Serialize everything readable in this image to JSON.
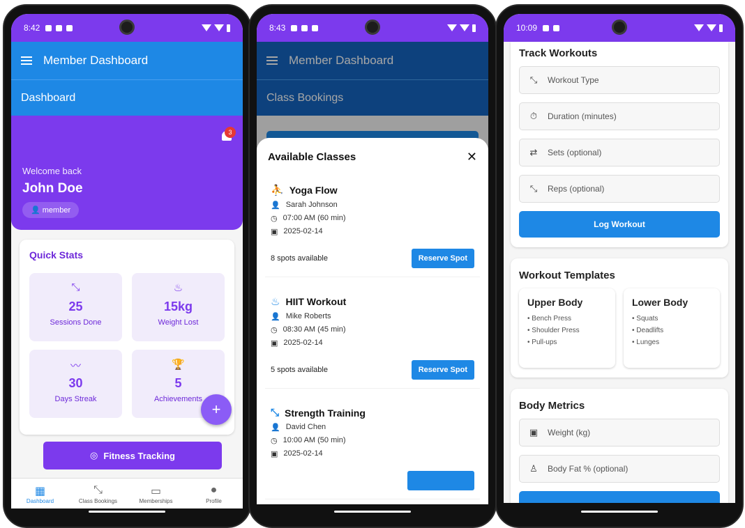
{
  "phone1": {
    "status_time": "8:42",
    "app_title": "Member Dashboard",
    "section_title": "Dashboard",
    "notification_count": "3",
    "welcome": "Welcome back",
    "user_name": "John Doe",
    "role": "member",
    "quick_stats_title": "Quick Stats",
    "stats": [
      {
        "icon": "dumbbell-icon",
        "glyph": "⤡",
        "value": "25",
        "label": "Sessions Done"
      },
      {
        "icon": "flame-icon",
        "glyph": "♨",
        "value": "15kg",
        "label": "Weight Lost"
      },
      {
        "icon": "trend-icon",
        "glyph": "〰",
        "value": "30",
        "label": "Days Streak"
      },
      {
        "icon": "trophy-icon",
        "glyph": "🏆",
        "value": "5",
        "label": "Achievements"
      }
    ],
    "fab": "+",
    "fitness_button": "Fitness Tracking",
    "nav": [
      {
        "label": "Dashboard",
        "glyph": "▦"
      },
      {
        "label": "Class Bookings",
        "glyph": "⤡"
      },
      {
        "label": "Memberships",
        "glyph": "▭"
      },
      {
        "label": "Profile",
        "glyph": "●"
      }
    ]
  },
  "phone2": {
    "status_time": "8:43",
    "app_title": "Member Dashboard",
    "section_title": "Class Bookings",
    "sheet_title": "Available Classes",
    "close": "✕",
    "classes": [
      {
        "icon": "yoga-icon",
        "glyph": "⛹",
        "name": "Yoga Flow",
        "instructor": "Sarah Johnson",
        "time": "07:00 AM (60 min)",
        "date": "2025-02-14",
        "spots": "8 spots available",
        "action": "Reserve Spot"
      },
      {
        "icon": "flame-icon",
        "glyph": "♨",
        "name": "HIIT Workout",
        "instructor": "Mike Roberts",
        "time": "08:30 AM (45 min)",
        "date": "2025-02-14",
        "spots": "5 spots available",
        "action": "Reserve Spot"
      },
      {
        "icon": "dumbbell-icon",
        "glyph": "⤡",
        "name": "Strength Training",
        "instructor": "David Chen",
        "time": "10:00 AM (50 min)",
        "date": "2025-02-14",
        "spots": "",
        "action": ""
      }
    ]
  },
  "phone3": {
    "status_time": "10:09",
    "track_title": "Track Workouts",
    "fields": [
      {
        "icon": "dumbbell-icon",
        "glyph": "⤡",
        "placeholder": "Workout Type"
      },
      {
        "icon": "timer-icon",
        "glyph": "⏱",
        "placeholder": "Duration (minutes)"
      },
      {
        "icon": "repeat-icon",
        "glyph": "⇄",
        "placeholder": "Sets (optional)"
      },
      {
        "icon": "dumbbell-icon",
        "glyph": "⤡",
        "placeholder": "Reps (optional)"
      }
    ],
    "log_button": "Log Workout",
    "templates_title": "Workout Templates",
    "templates": [
      {
        "name": "Upper Body",
        "items": [
          "• Bench Press",
          "• Shoulder Press",
          "• Pull-ups"
        ]
      },
      {
        "name": "Lower Body",
        "items": [
          "• Squats",
          "• Deadlifts",
          "• Lunges"
        ]
      }
    ],
    "metrics_title": "Body Metrics",
    "metric_fields": [
      {
        "icon": "scale-icon",
        "glyph": "▣",
        "placeholder": "Weight (kg)"
      },
      {
        "icon": "person-icon",
        "glyph": "♙",
        "placeholder": "Body Fat % (optional)"
      }
    ]
  }
}
